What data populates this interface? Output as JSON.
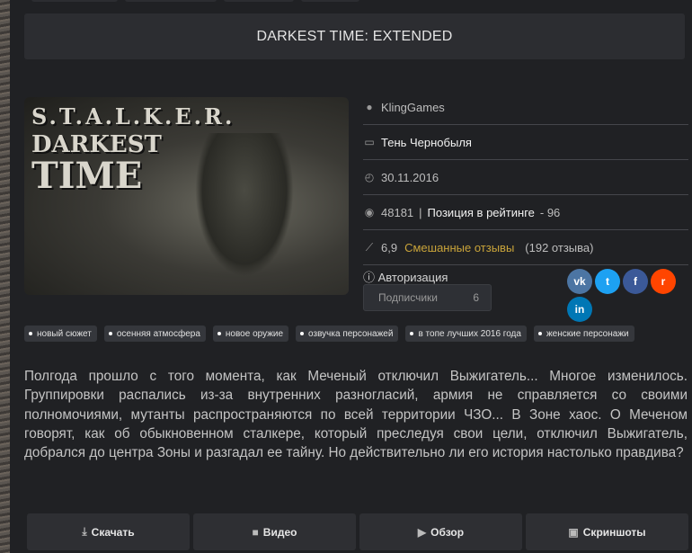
{
  "title": "DARKEST TIME: EXTENDED",
  "cover": {
    "line1": "S.T.A.L.K.E.R.",
    "line2": "DARKEST",
    "line3": "TIME"
  },
  "info": {
    "author": "KlingGames",
    "category": "Тень Чернобыля",
    "date": "30.11.2016",
    "views": "48181",
    "separator": "|",
    "rating_label": "Позиция в рейтинге",
    "rating_value": "- 96",
    "score": "6,9",
    "review_summary": "Смешанные отзывы",
    "review_count": "(192 отзыва)"
  },
  "auth": {
    "label": "Авторизация",
    "subscribers_label": "Подписчики",
    "subscribers_count": "6"
  },
  "social": {
    "vk": "vk",
    "twitter": "t",
    "facebook": "f",
    "reddit": "r",
    "linkedin": "in",
    "colors": {
      "vk": "#4c75a3",
      "twitter": "#1da1f2",
      "facebook": "#3b5998",
      "reddit": "#ff4500",
      "linkedin": "#0077b5"
    }
  },
  "tags": [
    "новый сюжет",
    "осенняя атмосфера",
    "новое оружие",
    "озвучка персонажей",
    "в топе лучших 2016 года",
    "женские персонажи"
  ],
  "description": "Полгода прошло с того момента, как Меченый отключил Выжигатель... Многое изменилось. Группировки распались из-за внутренних разногласий, армия не справляется со своими полномочиями, мутанты распространяются по всей территории ЧЗО... В Зоне хаос. О Меченом говорят, как об обыкновенном сталкере, который преследуя свои цели, отключил Выжигатель, добрался до центра Зоны и разгадал ее тайну. Но действительно ли его история настолько правдива?",
  "buttons": {
    "download": "Скачать",
    "video": "Видео",
    "review": "Обзор",
    "screenshots": "Скриншоты"
  }
}
